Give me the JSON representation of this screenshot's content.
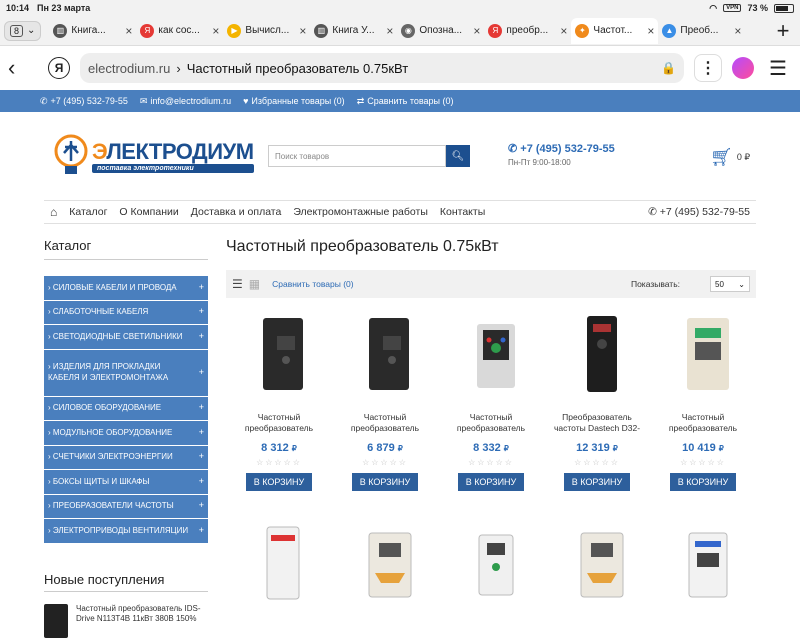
{
  "status": {
    "time": "10:14",
    "date": "Пн 23 марта",
    "vpn": "VPN",
    "battery": "73 %",
    "battery_level": 0.73
  },
  "tabs": {
    "count": "8",
    "items": [
      {
        "title": "Книга...",
        "favicon": "books-icon",
        "color": "#555555"
      },
      {
        "title": "как сос...",
        "favicon": "yandex-icon",
        "color": "#e53935"
      },
      {
        "title": "Вычисл...",
        "favicon": "play-icon",
        "color": "#f4b400"
      },
      {
        "title": "Книга У...",
        "favicon": "books-icon",
        "color": "#555555"
      },
      {
        "title": "Опозна...",
        "favicon": "eye-icon",
        "color": "#666666"
      },
      {
        "title": "преобр...",
        "favicon": "yandex-icon",
        "color": "#e53935"
      },
      {
        "title": "Частот...",
        "favicon": "bulb-icon",
        "color": "#f08a1c",
        "active": true
      },
      {
        "title": "Преоб...",
        "favicon": "triangle-icon",
        "color": "#3a8ee6"
      }
    ]
  },
  "address": {
    "domain": "electrodium.ru",
    "separator": "›",
    "title": "Частотный преобразователь 0.75кВт",
    "yandex": "Я"
  },
  "topbar": {
    "phone": "+7 (495) 532-79-55",
    "email": "info@electrodium.ru",
    "favorites": "Избранные товары (0)",
    "compare": "Сравнить товары (0)"
  },
  "header": {
    "brand_prefix": "Э",
    "brand_rest": "ЛЕКТРОДИУМ",
    "brand_sub": "поставка электротехники",
    "search_placeholder": "Поиск товаров",
    "phone": "+7 (495) 532-79-55",
    "hours": "Пн-Пт 9:00-18:00",
    "cart_total": "0 ₽"
  },
  "nav": {
    "items": [
      "Каталог",
      "О Компании",
      "Доставка и оплата",
      "Электромонтажные работы",
      "Контакты"
    ],
    "phone": "+7 (495) 532-79-55"
  },
  "sidebar": {
    "title": "Каталог",
    "categories": [
      "› СИЛОВЫЕ КАБЕЛИ И ПРОВОДА",
      "› СЛАБОТОЧНЫЕ КАБЕЛЯ",
      "› СВЕТОДИОДНЫЕ СВЕТИЛЬНИКИ",
      "› ИЗДЕЛИЯ ДЛЯ ПРОКЛАДКИ КАБЕЛЯ И ЭЛЕКТРОМОНТАЖА",
      "› СИЛОВОЕ ОБОРУДОВАНИЕ",
      "› МОДУЛЬНОЕ ОБОРУДОВАНИЕ",
      "› СЧЕТЧИКИ ЭЛЕКТРОЭНЕРГИИ",
      "› БОКСЫ ЩИТЫ И ШКАФЫ",
      "› ПРЕОБРАЗОВАТЕЛИ ЧАСТОТЫ",
      "› ЭЛЕКТРОПРИВОДЫ ВЕНТИЛЯЦИИ"
    ],
    "new_title": "Новые поступления",
    "new_item": "Частотный преобразователь IDS-Drive N113T4B 11кВт 380В 150%"
  },
  "main": {
    "title": "Частотный преобразователь 0.75кВт",
    "compare": "Сравнить товары (0)",
    "show_label": "Показывать:",
    "show_value": "50",
    "buy_label": "В КОРЗИНУ",
    "stars": "☆☆☆☆☆",
    "currency": "₽",
    "products": [
      {
        "name": "Частотный преобразователь",
        "price": "8 312",
        "style": "black"
      },
      {
        "name": "Частотный преобразователь",
        "price": "6 879",
        "style": "black"
      },
      {
        "name": "Частотный преобразователь",
        "price": "8 332",
        "style": "small"
      },
      {
        "name": "Преобразователь частоты Dastech D32-",
        "price": "12 319",
        "style": "tall"
      },
      {
        "name": "Частотный преобразователь",
        "price": "10 419",
        "style": "beige"
      }
    ],
    "products_row2": [
      "white-red",
      "white",
      "small-white",
      "white",
      "white-blue"
    ]
  }
}
